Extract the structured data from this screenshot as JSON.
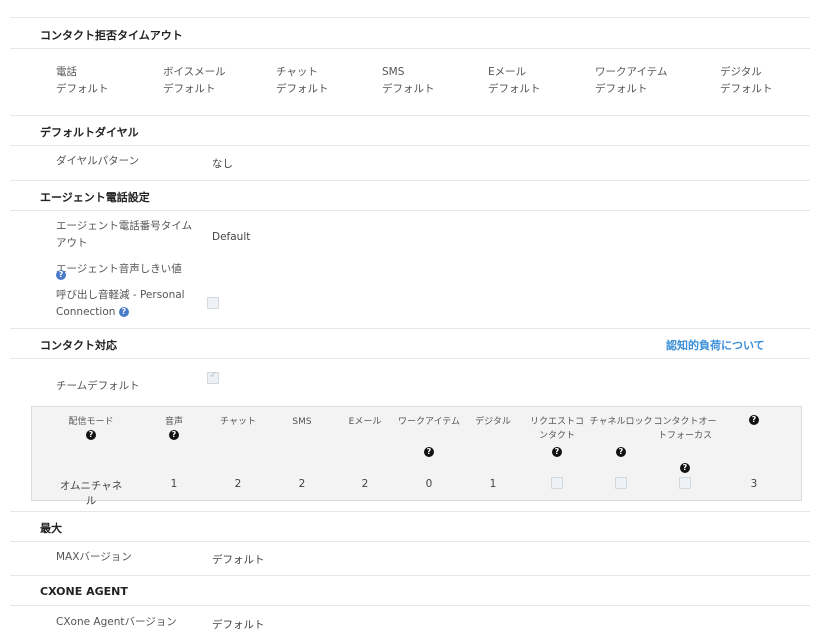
{
  "sections": {
    "contact_reject_timeout": "コンタクト拒否タイムアウト",
    "default_dial": "デフォルトダイヤル",
    "agent_phone": "エージェント電話設定",
    "contact_handling": "コンタクト対応",
    "max": "最大",
    "cxone_agent": "CXONE AGENT"
  },
  "timeout_channels": [
    {
      "name": "電話",
      "value": "デフォルト"
    },
    {
      "name": "ボイスメール",
      "value": "デフォルト"
    },
    {
      "name": "チャット",
      "value": "デフォルト"
    },
    {
      "name": "SMS",
      "value": "デフォルト"
    },
    {
      "name": "Eメール",
      "value": "デフォルト"
    },
    {
      "name": "ワークアイテム",
      "value": "デフォルト"
    },
    {
      "name": "デジタル",
      "value": "デフォルト"
    }
  ],
  "dial": {
    "label": "ダイヤルパターン",
    "value": "なし"
  },
  "agent_phone": {
    "timeout_label": "エージェント電話番号タイムアウト",
    "timeout_value": "Default",
    "threshold_label": "エージェント音声しきい値",
    "reduce_label": "呼び出し音軽減 - Personal Connection",
    "reduce_checked": false
  },
  "contact_handling": {
    "link": "認知的負荷について",
    "team_default_label": "チームデフォルト",
    "team_default_checked": true,
    "columns": [
      "配信モード",
      "音声",
      "チャット",
      "SMS",
      "Eメール",
      "ワークアイテム",
      "デジタル",
      "リクエストコンタクト",
      "チャネルロック",
      "コンタクトオートフォーカス",
      ""
    ],
    "row": {
      "mode": "オムニチャネル",
      "voice": "1",
      "chat": "2",
      "sms": "2",
      "email": "2",
      "workitem": "0",
      "digital": "1",
      "request_contact": false,
      "channel_lock": false,
      "autofocus": false,
      "last": "3"
    }
  },
  "max": {
    "label": "MAXバージョン",
    "value": "デフォルト"
  },
  "cxone": {
    "label": "CXone Agentバージョン",
    "value": "デフォルト"
  },
  "icons": {
    "help_blue": "question-circle-icon",
    "help_black": "question-circle-icon"
  }
}
